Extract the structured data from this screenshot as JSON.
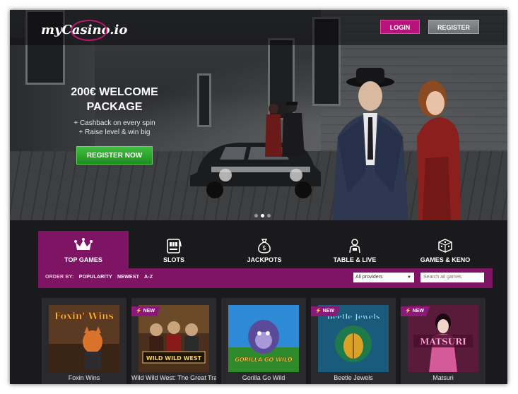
{
  "header": {
    "logo_text": "myCasino.io",
    "login_label": "LOGIN",
    "register_label": "REGISTER"
  },
  "hero": {
    "headline_line1": "200€ WELCOME",
    "headline_line2": "PACKAGE",
    "bullet1": "+ Cashback on every spin",
    "bullet2": "+ Raise level & win big",
    "cta_label": "REGISTER NOW",
    "slides_total": 3,
    "slide_active": 2
  },
  "categories": [
    {
      "label": "TOP GAMES",
      "icon": "crown-icon",
      "active": true
    },
    {
      "label": "SLOTS",
      "icon": "slot-machine-icon",
      "active": false
    },
    {
      "label": "JACKPOTS",
      "icon": "money-bag-icon",
      "active": false
    },
    {
      "label": "TABLE & LIVE",
      "icon": "dealer-icon",
      "active": false
    },
    {
      "label": "GAMES & KENO",
      "icon": "dice-icon",
      "active": false
    }
  ],
  "filter": {
    "order_by_label": "ORDER BY:",
    "options": [
      "POPULARITY",
      "NEWEST",
      "A-Z"
    ],
    "provider_value": "All providers",
    "search_placeholder": "Search all games"
  },
  "games": [
    {
      "name": "Foxin Wins",
      "new": false,
      "thumb_label": "Foxin' Wins"
    },
    {
      "name": "Wild Wild West: The Great Train Heist",
      "new": true,
      "thumb_label": "WILD WILD WEST"
    },
    {
      "name": "Gorilla Go Wild",
      "new": false,
      "thumb_label": "GORILLA GO WILD"
    },
    {
      "name": "Beetle Jewels",
      "new": true,
      "thumb_label": "Beetle Jewels"
    },
    {
      "name": "Matsuri",
      "new": true,
      "thumb_label": "MATSURI"
    }
  ],
  "badge_new_label": "NEW",
  "colors": {
    "accent": "#7f1464",
    "login": "#b8137a",
    "cta": "#2aa52a"
  }
}
